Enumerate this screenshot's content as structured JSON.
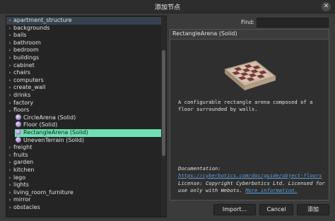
{
  "window": {
    "title": "添加节点",
    "close_glyph": "✕"
  },
  "tree": {
    "top_items": [
      "apartment_structure",
      "backgrounds",
      "balls",
      "bathroom",
      "bedroom",
      "buildings",
      "cabinet",
      "chairs",
      "computers",
      "create_wall",
      "drinks",
      "factory"
    ],
    "expanded": {
      "label": "floors",
      "children": [
        "CircleArena (Solid)",
        "Floor (Solid)",
        "RectangleArena (Solid)",
        "UnevenTerrain (Solid)"
      ],
      "selected_index": 2
    },
    "bottom_items": [
      "freight",
      "fruits",
      "garden",
      "kitchen",
      "lego",
      "lights",
      "living_room_furniture",
      "mirror",
      "obstacles"
    ]
  },
  "find": {
    "label": "Find:",
    "value": ""
  },
  "info": {
    "node_title": "RectangleArena (Solid)",
    "description": "A configurable rectangle arena composed of a floor surrounded by walls.",
    "doc_prefix": "Documentation: ",
    "doc_link": "https://cyberbotics.com/doc/guide/object-floors",
    "license_text": "License: Copyright Cyberbotics Ltd. Licensed for use only with Webots. ",
    "license_link": "More information."
  },
  "buttons": {
    "import": "Import...",
    "cancel": "Cancel",
    "add": "添加"
  },
  "colors": {
    "selection": "#6fe0b3",
    "link": "#5d9edd",
    "background": "#3b3b3b"
  }
}
